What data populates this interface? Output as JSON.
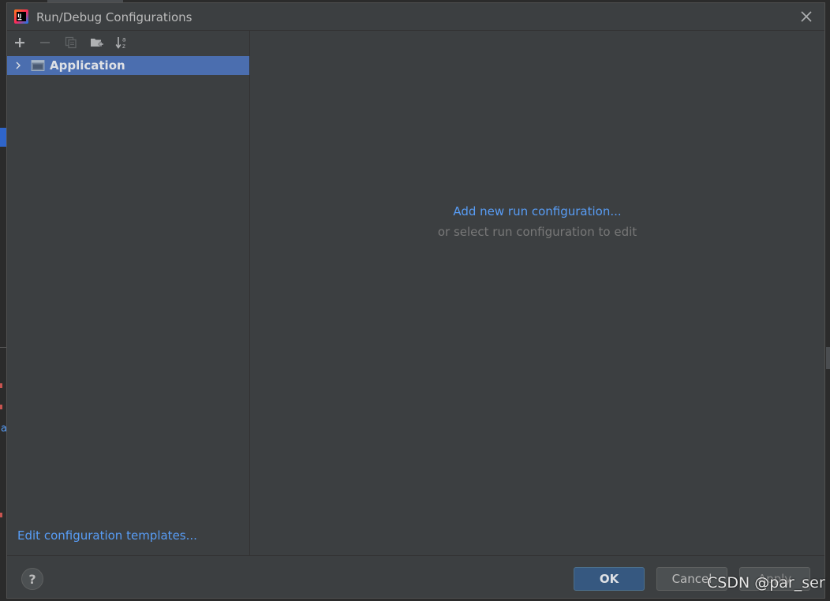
{
  "window": {
    "title": "Run/Debug Configurations"
  },
  "toolbar": {
    "add_icon": "plus-icon",
    "remove_icon": "minus-icon",
    "copy_icon": "copy-icon",
    "folder_icon": "new-folder-icon",
    "sort_icon": "sort-alphabetically-icon"
  },
  "tree": {
    "items": [
      {
        "label": "Application",
        "icon": "application-config-icon",
        "expanded": false,
        "selected": true
      }
    ]
  },
  "left_pane": {
    "templates_link": "Edit configuration templates..."
  },
  "right_pane": {
    "add_link": "Add new run configuration...",
    "hint": "or select run configuration to edit"
  },
  "footer": {
    "help_label": "?",
    "ok_label": "OK",
    "cancel_label": "Cancel",
    "apply_label": "Apply"
  },
  "background": {
    "link_fragment": "a"
  },
  "watermark": {
    "text": "CSDN @par_ser"
  },
  "colors": {
    "dialog_bg": "#3c3f41",
    "selection": "#4b6eaf",
    "link": "#589df6",
    "ok_button": "#365880"
  }
}
